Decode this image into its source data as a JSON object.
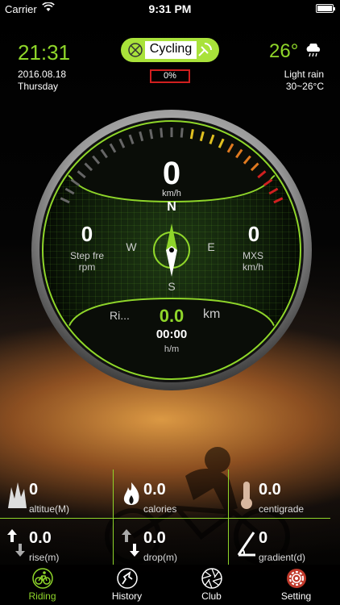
{
  "status_bar": {
    "carrier": "Carrier",
    "time": "9:31 PM"
  },
  "header": {
    "clock": "21:31",
    "date": "2016.08.18",
    "weekday": "Thursday",
    "mode_label": "Cycling",
    "progress_text": "0%",
    "temperature": "26°",
    "weather": "Light rain",
    "temp_range": "30~26°C",
    "weather_icon": "rain-cloud-icon"
  },
  "gauge": {
    "speed": "0",
    "speed_unit": "km/h",
    "compass": {
      "n": "N",
      "w": "W",
      "e": "E",
      "s": "S"
    },
    "left_value": "0",
    "left_label_1": "Step fre",
    "left_label_2": "rpm",
    "right_value": "0",
    "right_label_1": "MXS",
    "right_label_2": "km/h",
    "distance_label": "Ri...",
    "distance": "0.0",
    "distance_unit": "km",
    "duration": "00:00",
    "duration_unit": "h/m"
  },
  "stats": [
    {
      "value": "0",
      "label": "altitue(M)",
      "icon": "altitude-icon"
    },
    {
      "value": "0.0",
      "label": "calories",
      "icon": "flame-icon"
    },
    {
      "value": "0.0",
      "label": "centigrade",
      "icon": "thermometer-icon"
    },
    {
      "value": "0.0",
      "label": "rise(m)",
      "icon": "rise-arrows-icon"
    },
    {
      "value": "0.0",
      "label": "drop(m)",
      "icon": "drop-arrows-icon"
    },
    {
      "value": "0",
      "label": "gradient(d)",
      "icon": "gradient-icon"
    }
  ],
  "tabs": [
    {
      "label": "Riding",
      "icon": "bike-icon",
      "active": true
    },
    {
      "label": "History",
      "icon": "route-icon",
      "active": false
    },
    {
      "label": "Club",
      "icon": "aperture-icon",
      "active": false
    },
    {
      "label": "Setting",
      "icon": "gear-icon",
      "active": false
    }
  ],
  "colors": {
    "accent": "#8fd62a",
    "alert": "#d01f1f"
  }
}
